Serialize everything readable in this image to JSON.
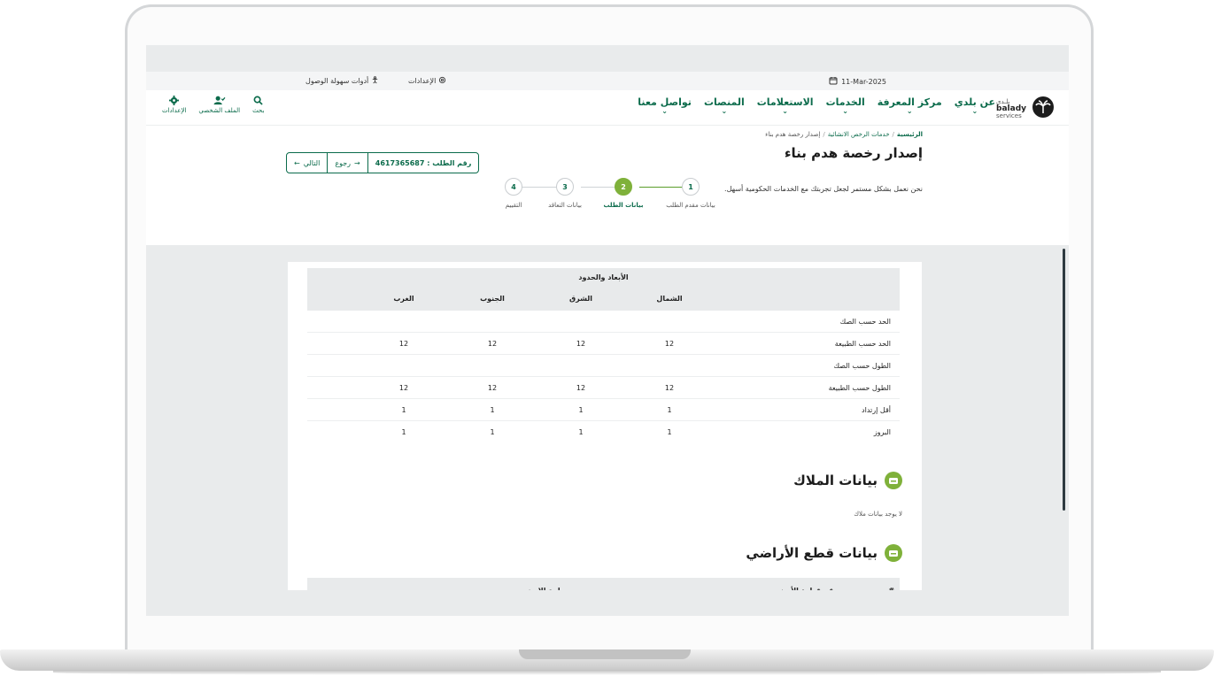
{
  "topbar": {
    "date": "11-Mar-2025",
    "settings_label": "الإعدادات",
    "accessibility_label": "أدوات سهولة الوصول"
  },
  "logo": {
    "arabic": "بلـدي",
    "latin": "balady",
    "sub": "services"
  },
  "nav": {
    "items": [
      {
        "label": "عن بلدي"
      },
      {
        "label": "مركز المعرفة"
      },
      {
        "label": "الخدمات"
      },
      {
        "label": "الاستعلامات"
      },
      {
        "label": "المنصات"
      },
      {
        "label": "تواصل معنا"
      }
    ]
  },
  "tools": {
    "search": "بحث",
    "profile": "الملف الشخصي",
    "settings": "الإعدادات"
  },
  "breadcrumb": {
    "home": "الرئيسية",
    "section": "خدمات الرخص الانشائية",
    "current": "إصدار رخصة هدم بناء"
  },
  "page": {
    "title": "إصدار رخصة هدم بناء",
    "subtitle": "نحن نعمل بشكل مستمر لجعل تجربتك مع الخدمات الحكومية أسهل."
  },
  "request": {
    "number_label": "رقم الطلب : 4617365687",
    "back_label": "رجوع",
    "next_label": "التالي"
  },
  "stepper": {
    "steps": [
      {
        "num": "1",
        "label": "بيانات مقدم الطلب"
      },
      {
        "num": "2",
        "label": "بيانات الطلب"
      },
      {
        "num": "3",
        "label": "بيانات التعاقد"
      },
      {
        "num": "4",
        "label": "التقييم"
      }
    ],
    "active_index": 1
  },
  "dimensions": {
    "title": "الأبعاد والحدود",
    "columns": [
      "الشمال",
      "الشرق",
      "الجنوب",
      "الغرب"
    ],
    "rows": [
      {
        "label": "الحد حسب الصك",
        "values": [
          "",
          "",
          "",
          ""
        ]
      },
      {
        "label": "الحد حسب الطبيعة",
        "values": [
          "12",
          "12",
          "12",
          "12"
        ]
      },
      {
        "label": "الطول حسب الصك",
        "values": [
          "",
          "",
          "",
          ""
        ]
      },
      {
        "label": "الطول حسب الطبيعة",
        "values": [
          "12",
          "12",
          "12",
          "12"
        ]
      },
      {
        "label": "أقل إرتداد",
        "values": [
          "1",
          "1",
          "1",
          "1"
        ]
      },
      {
        "label": "البروز",
        "values": [
          "1",
          "1",
          "1",
          "1"
        ]
      }
    ]
  },
  "owners": {
    "title": "بيانات الملاك",
    "empty": "لا يوجد بيانات ملاك"
  },
  "lands": {
    "title": "بيانات قطع الأراضي",
    "columns": [
      "#",
      "رقم قطعة الأرض",
      "مساحة الارض"
    ]
  },
  "colors": {
    "primary": "#0b6b4b",
    "accent": "#7fb13a"
  }
}
